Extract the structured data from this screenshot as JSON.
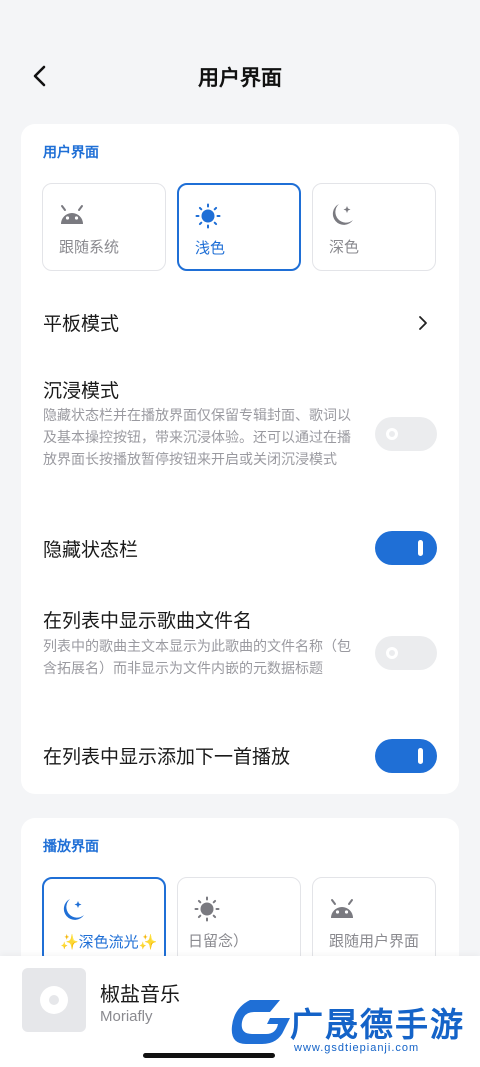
{
  "header": {
    "title": "用户界面"
  },
  "ui_section": {
    "title": "用户界面",
    "themes": [
      {
        "label": "跟随系统",
        "icon": "android-icon",
        "selected": false
      },
      {
        "label": "浅色",
        "icon": "sun-icon",
        "selected": true
      },
      {
        "label": "深色",
        "icon": "moon-icon",
        "selected": false
      }
    ],
    "tablet_mode": {
      "title": "平板模式"
    },
    "immersive": {
      "title": "沉浸模式",
      "desc": "隐藏状态栏并在播放界面仅保留专辑封面、歌词以及基本操控按钮，带来沉浸体验。还可以通过在播放界面长按播放暂停按钮来开启或关闭沉浸模式",
      "enabled": false
    },
    "hide_statusbar": {
      "title": "隐藏状态栏",
      "enabled": true
    },
    "show_filename": {
      "title": "在列表中显示歌曲文件名",
      "desc": "列表中的歌曲主文本显示为此歌曲的文件名称（包含拓展名）而非显示为文件内嵌的元数据标题",
      "enabled": false
    },
    "show_add_next": {
      "title": "在列表中显示添加下一首播放",
      "enabled": true
    }
  },
  "player_section": {
    "title": "播放界面",
    "themes": [
      {
        "label": "✨深色流光✨",
        "icon": "moon-icon",
        "selected": true
      },
      {
        "label": "日留念）",
        "icon": "sun-icon",
        "selected": false
      },
      {
        "label": "跟随用户界面",
        "icon": "android-icon",
        "selected": false
      }
    ]
  },
  "mini_player": {
    "title": "椒盐音乐",
    "artist": "Moriafly"
  },
  "watermark": {
    "name": "广晟德手游",
    "url": "www.gsdtiepianji.com"
  },
  "colors": {
    "accent": "#1f6fd6",
    "background": "#f4f5f7",
    "card": "#ffffff"
  }
}
